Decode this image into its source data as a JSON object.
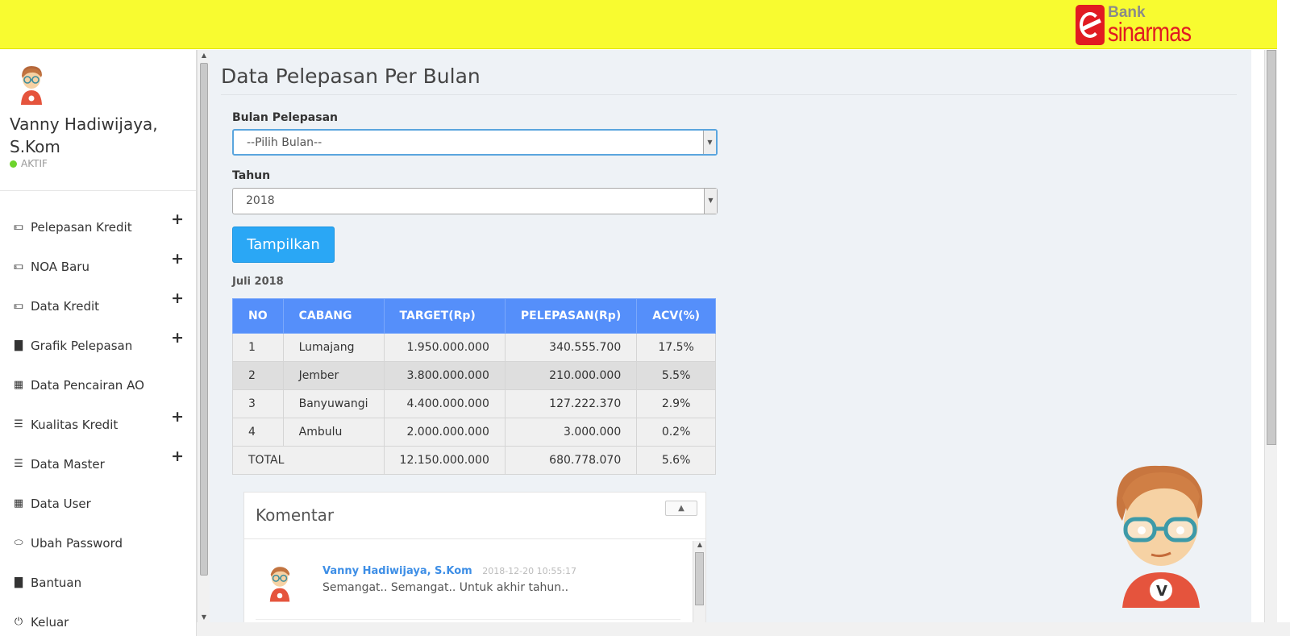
{
  "header": {
    "brand_top": "Bank",
    "brand_bottom": "sinarmas",
    "brand_color": "#e11b22",
    "background": "#f8fb30"
  },
  "user": {
    "name": "Vanny Hadiwijaya, S.Kom",
    "status": "AKTIF",
    "status_color": "#6dd42c"
  },
  "sidebar": {
    "items": [
      {
        "label": "Pelepasan Kredit",
        "icon": "money-icon",
        "expandable": true
      },
      {
        "label": "NOA Baru",
        "icon": "money-icon",
        "expandable": true
      },
      {
        "label": "Data Kredit",
        "icon": "money-icon",
        "expandable": true
      },
      {
        "label": "Grafik Pelepasan",
        "icon": "bar-chart-icon",
        "expandable": true
      },
      {
        "label": "Data Pencairan AO",
        "icon": "calendar-icon",
        "expandable": false
      },
      {
        "label": "Kualitas Kredit",
        "icon": "list-icon",
        "expandable": true
      },
      {
        "label": "Data Master",
        "icon": "list-icon",
        "expandable": true
      },
      {
        "label": "Data User",
        "icon": "calendar-icon",
        "expandable": false
      },
      {
        "label": "Ubah Password",
        "icon": "toggle-icon",
        "expandable": false
      },
      {
        "label": "Bantuan",
        "icon": "bar-chart-icon",
        "expandable": false
      },
      {
        "label": "Keluar",
        "icon": "power-icon",
        "expandable": false
      }
    ]
  },
  "main": {
    "title": "Data Pelepasan Per Bulan",
    "form": {
      "month_label": "Bulan Pelepasan",
      "month_value": "--Pilih Bulan--",
      "year_label": "Tahun",
      "year_value": "2018",
      "submit_label": "Tampilkan"
    },
    "period": "Juli  2018",
    "table": {
      "headers": [
        "NO",
        "CABANG",
        "TARGET(Rp)",
        "PELEPASAN(Rp)",
        "ACV(%)"
      ],
      "rows": [
        [
          "1",
          "Lumajang",
          "1.950.000.000",
          "340.555.700",
          "17.5%"
        ],
        [
          "2",
          "Jember",
          "3.800.000.000",
          "210.000.000",
          "5.5%"
        ],
        [
          "3",
          "Banyuwangi",
          "4.400.000.000",
          "127.222.370",
          "2.9%"
        ],
        [
          "4",
          "Ambulu",
          "2.000.000.000",
          "3.000.000",
          "0.2%"
        ]
      ],
      "total": {
        "label": "TOTAL",
        "target": "12.150.000.000",
        "pelepasan": "680.778.070",
        "acv": "5.6%"
      },
      "header_color": "#558ffa"
    },
    "comments": {
      "title": "Komentar",
      "items": [
        {
          "author": "Vanny Hadiwijaya, S.Kom",
          "time": "2018-12-20 10:55:17",
          "text": "Semangat.. Semangat.. Untuk akhir tahun.."
        }
      ]
    }
  }
}
